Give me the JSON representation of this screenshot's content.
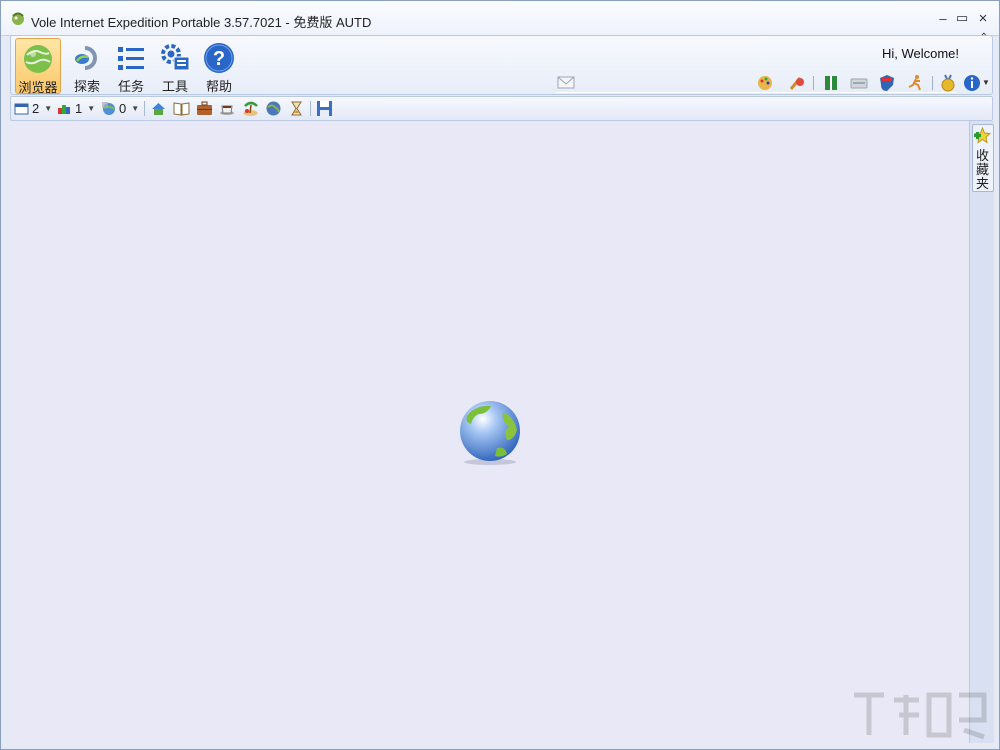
{
  "window": {
    "title": "Vole Internet Expedition Portable  3.57.7021 - 免费版 AUTD",
    "minimize": "–",
    "maximize": "▭",
    "close": "×"
  },
  "ribbon": {
    "buttons": [
      {
        "label": "浏览器",
        "icon": "globe-browser-icon"
      },
      {
        "label": "探索",
        "icon": "explore-icon"
      },
      {
        "label": "任务",
        "icon": "task-list-icon"
      },
      {
        "label": "工具",
        "icon": "tools-gear-icon"
      },
      {
        "label": "帮助",
        "icon": "help-icon"
      }
    ],
    "welcome": "Hi, Welcome!",
    "collapse": "⌃"
  },
  "toolbar2": {
    "windows_count": "2",
    "groups_count": "1",
    "sessions_count": "0"
  },
  "sidebar": {
    "favorites_label": "收藏夹"
  },
  "colors": {
    "content_bg": "#e8e8f7",
    "active_button": "#fbc769",
    "accent_blue": "#2a66c8"
  }
}
